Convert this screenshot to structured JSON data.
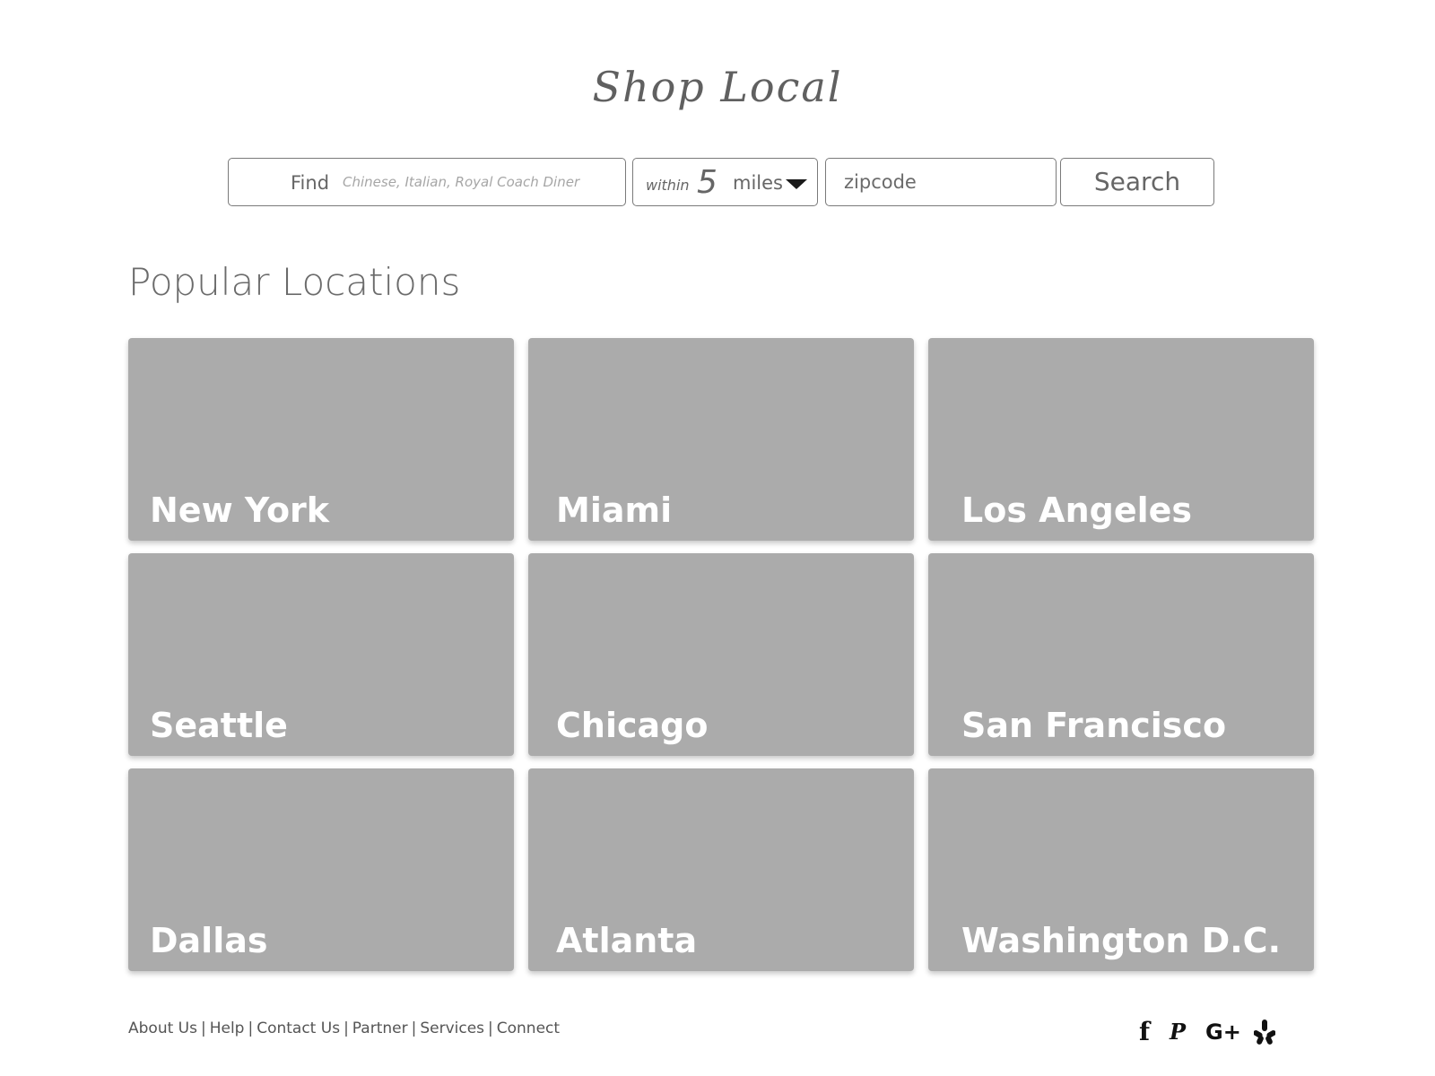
{
  "brand": {
    "title": "Shop Local"
  },
  "search": {
    "find_label": "Find",
    "find_placeholder": "Chinese, Italian, Royal Coach Diner",
    "within_label": "within",
    "within_value": "5",
    "within_unit": "miles",
    "zip_placeholder": "zipcode",
    "button_label": "Search"
  },
  "popular": {
    "title": "Popular Locations",
    "locations": [
      "New York",
      "Miami",
      "Los Angeles",
      "Seattle",
      "Chicago",
      "San Francisco",
      "Dallas",
      "Atlanta",
      "Washington D.C."
    ]
  },
  "footer": {
    "links": [
      "About Us",
      "Help",
      "Contact Us",
      "Partner",
      "Services",
      "Connect"
    ],
    "separator": "|"
  },
  "social": {
    "icons": [
      "facebook-icon",
      "pinterest-icon",
      "google-plus-icon",
      "yelp-icon"
    ],
    "facebook_glyph": "f",
    "pinterest_glyph": "P",
    "google_glyph": "G+"
  },
  "colors": {
    "tile_bg": "#ababab",
    "text": "#6b6b6b",
    "tile_text": "#ffffff"
  }
}
